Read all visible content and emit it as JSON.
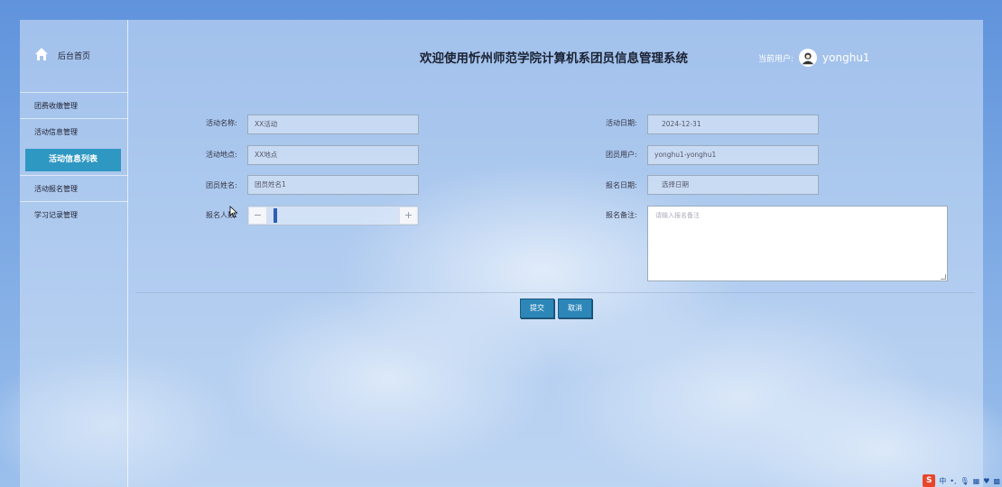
{
  "sidebar": {
    "home_label": "后台首页",
    "items": [
      {
        "label": "团费收缴管理",
        "active": false
      },
      {
        "label": "活动信息管理",
        "active": false
      },
      {
        "label": "活动信息列表",
        "active": true
      },
      {
        "label": "活动报名管理",
        "active": false
      },
      {
        "label": "学习记录管理",
        "active": false
      }
    ]
  },
  "header": {
    "title": "欢迎使用忻州师范学院计算机系团员信息管理系统",
    "user_label": "当前用户:",
    "username": "yonghu1"
  },
  "form": {
    "activity_name": {
      "label": "活动名称:",
      "value": "XX活动"
    },
    "activity_date": {
      "label": "活动日期:",
      "value": "2024-12-31"
    },
    "activity_location": {
      "label": "活动地点:",
      "value": "XX地点"
    },
    "member_user": {
      "label": "团员用户:",
      "value": "yonghu1-yonghu1"
    },
    "member_name": {
      "label": "团员姓名:",
      "value": "团员姓名1"
    },
    "signup_date": {
      "label": "报名日期:",
      "value": "选择日期"
    },
    "signup_count": {
      "label": "报名人数:",
      "value": "",
      "minus": "−",
      "plus": "+"
    },
    "signup_note": {
      "label": "报名备注:",
      "placeholder": "请输入报名备注"
    }
  },
  "actions": {
    "submit": "提交",
    "cancel": "取消"
  },
  "tray": {
    "ime": "S",
    "lang": "中"
  },
  "colors": {
    "accent": "#2e97c2",
    "button": "#2c86b8"
  }
}
